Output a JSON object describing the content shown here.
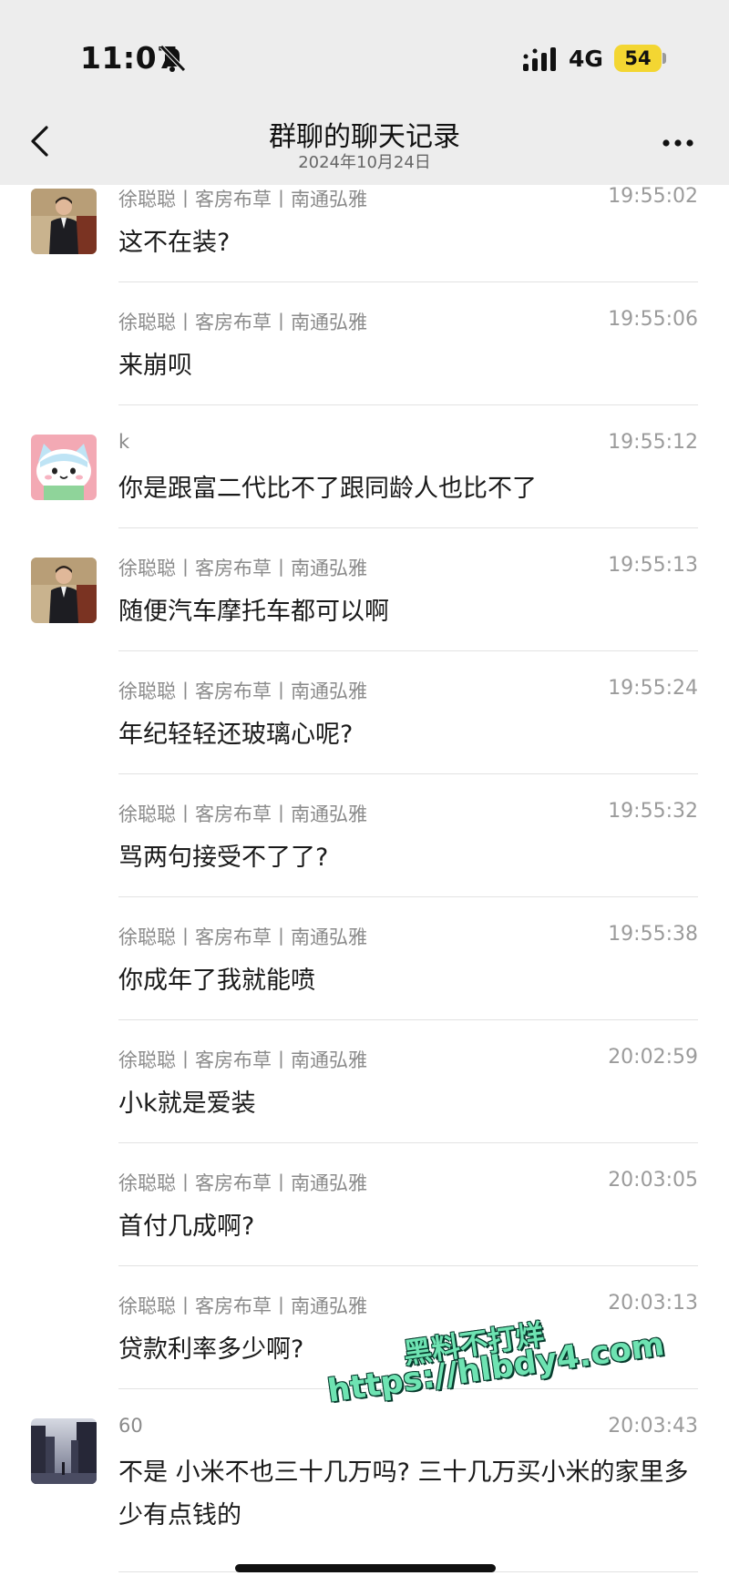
{
  "status_bar": {
    "time": "11:07",
    "network": "4G",
    "battery": "54",
    "battery_color": "#f3d632"
  },
  "nav": {
    "title": "群聊的聊天记录",
    "subtitle": "2024年10月24日"
  },
  "messages": [
    {
      "sender": "徐聪聪丨客房布草丨南通弘雅",
      "time": "19:55:02",
      "text": "这不在装?",
      "avatar": "man"
    },
    {
      "sender": "徐聪聪丨客房布草丨南通弘雅",
      "time": "19:55:06",
      "text": "来崩呗",
      "avatar": ""
    },
    {
      "sender": "k",
      "time": "19:55:12",
      "text": "你是跟富二代比不了跟同龄人也比不了",
      "avatar": "cat"
    },
    {
      "sender": "徐聪聪丨客房布草丨南通弘雅",
      "time": "19:55:13",
      "text": "随便汽车摩托车都可以啊",
      "avatar": "man"
    },
    {
      "sender": "徐聪聪丨客房布草丨南通弘雅",
      "time": "19:55:24",
      "text": "年纪轻轻还玻璃心呢?",
      "avatar": ""
    },
    {
      "sender": "徐聪聪丨客房布草丨南通弘雅",
      "time": "19:55:32",
      "text": "骂两句接受不了了?",
      "avatar": ""
    },
    {
      "sender": "徐聪聪丨客房布草丨南通弘雅",
      "time": "19:55:38",
      "text": "你成年了我就能喷",
      "avatar": ""
    },
    {
      "sender": "徐聪聪丨客房布草丨南通弘雅",
      "time": "20:02:59",
      "text": "小k就是爱装",
      "avatar": ""
    },
    {
      "sender": "徐聪聪丨客房布草丨南通弘雅",
      "time": "20:03:05",
      "text": "首付几成啊?",
      "avatar": ""
    },
    {
      "sender": "徐聪聪丨客房布草丨南通弘雅",
      "time": "20:03:13",
      "text": "贷款利率多少啊?",
      "avatar": ""
    },
    {
      "sender": "60",
      "time": "20:03:43",
      "text": "不是 小米不也三十几万吗? 三十几万买小米的家里多少有点钱的",
      "avatar": "city"
    }
  ],
  "watermark": {
    "line1": "黑料不打烊",
    "line2": "https://hlbdy4.com"
  }
}
